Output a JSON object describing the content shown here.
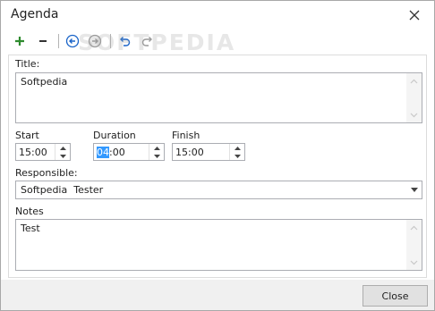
{
  "window": {
    "title": "Agenda"
  },
  "watermark": "SOFTPEDIA",
  "form": {
    "title_label": "Title:",
    "title_value": "Softpedia",
    "start_label": "Start",
    "start_value": "15:00",
    "duration_label": "Duration",
    "duration_value_selected": "04",
    "duration_value_rest": ":00",
    "finish_label": "Finish",
    "finish_value": "15:00",
    "responsible_label": "Responsible:",
    "responsible_value": "Softpedia  Tester",
    "notes_label": "Notes",
    "notes_value": "Test"
  },
  "footer": {
    "close_label": "Close"
  },
  "colors": {
    "add": "#2e8b2e",
    "remove": "#333333",
    "nav": "#1a64c8",
    "highlight": "#3399ff"
  },
  "toolbar": {
    "icons": [
      "add-icon",
      "remove-icon",
      "back-icon",
      "forward-icon",
      "undo-icon",
      "redo-icon"
    ]
  }
}
